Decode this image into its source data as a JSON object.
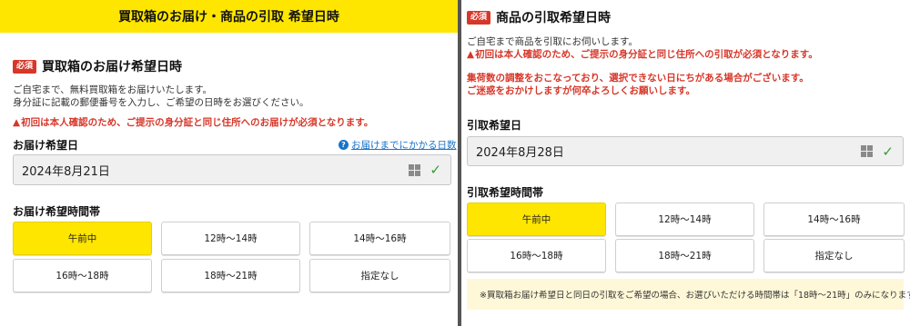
{
  "left": {
    "banner_title": "買取箱のお届け・商品の引取 希望日時",
    "required_badge": "必須",
    "section_title": "買取箱のお届け希望日時",
    "desc_line1": "ご自宅まで、無料買取箱をお届けいたします。",
    "desc_line2": "身分証に記載の郵便番号を入力し、ご希望の日時をお選びください。",
    "warning": "初回は本人確認のため、ご提示の身分証と同じ住所へのお届けが必須となります。",
    "date_label": "お届け希望日",
    "help_link": "お届けまでにかかる日数",
    "date_value": "2024年8月21日",
    "time_label": "お届け希望時間帯",
    "time_slots": [
      "午前中",
      "12時〜14時",
      "14時〜16時",
      "16時〜18時",
      "18時〜21時",
      "指定なし"
    ],
    "selected_slot": "午前中"
  },
  "right": {
    "required_badge": "必須",
    "section_title": "商品の引取希望日時",
    "desc_line1": "ご自宅まで商品を引取にお伺いします。",
    "warning": "初回は本人確認のため、ご提示の身分証と同じ住所への引取が必須となります。",
    "notice_line1": "集荷数の調整をおこなっており、選択できない日にちがある場合がございます。",
    "notice_line2": "ご迷惑をおかけしますが何卒よろしくお願いします。",
    "date_label": "引取希望日",
    "date_value": "2024年8月28日",
    "time_label": "引取希望時間帯",
    "time_slots": [
      "午前中",
      "12時〜14時",
      "14時〜16時",
      "16時〜18時",
      "18時〜21時",
      "指定なし"
    ],
    "selected_slot": "午前中",
    "footnote": "※買取箱お届け希望日と同日の引取をご希望の場合、お選びいただける時間帯は「18時〜21時」のみになります。"
  },
  "colors": {
    "accent_yellow": "#ffe600",
    "required_red": "#d7372a",
    "link_blue": "#1a73c8",
    "check_green": "#3a9b3a",
    "note_bg": "#fff8d8"
  },
  "icons": {
    "warning": "warning-triangle-icon",
    "help": "question-circle-icon",
    "calendar": "calendar-grid-icon",
    "valid": "check-icon"
  }
}
